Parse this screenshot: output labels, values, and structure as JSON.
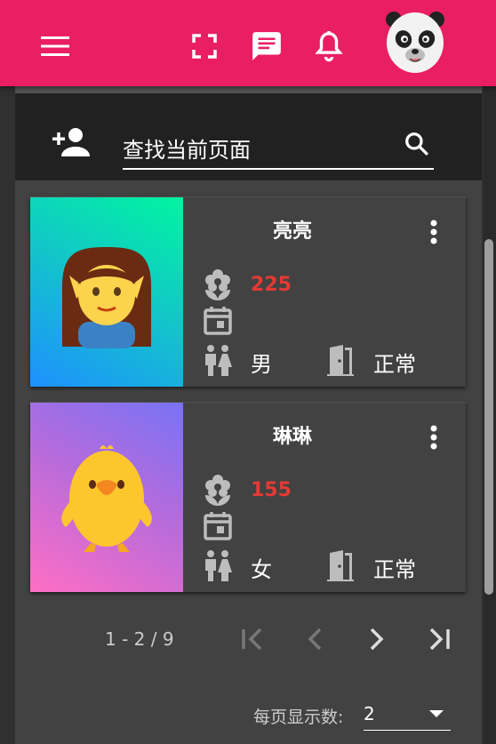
{
  "topbar": {
    "icons": [
      "menu-icon",
      "fullscreen-icon",
      "chat-icon",
      "bell-icon",
      "panda-avatar"
    ],
    "accent_color": "#e91e63"
  },
  "search": {
    "placeholder": "查找当前页面",
    "value": ""
  },
  "cards": [
    {
      "name": "亮亮",
      "points": "225",
      "gender": "男",
      "status": "正常",
      "image": "elf-woman-emoji"
    },
    {
      "name": "琳琳",
      "points": "155",
      "gender": "女",
      "status": "正常",
      "image": "baby-chick-emoji"
    }
  ],
  "pagination": {
    "range": "1 - 2 / 9",
    "page_size_label": "每页显示数:",
    "page_size": "2"
  },
  "colors": {
    "points": "#e53935",
    "background": "#303030",
    "card": "#424242",
    "search_bar": "#212121"
  }
}
